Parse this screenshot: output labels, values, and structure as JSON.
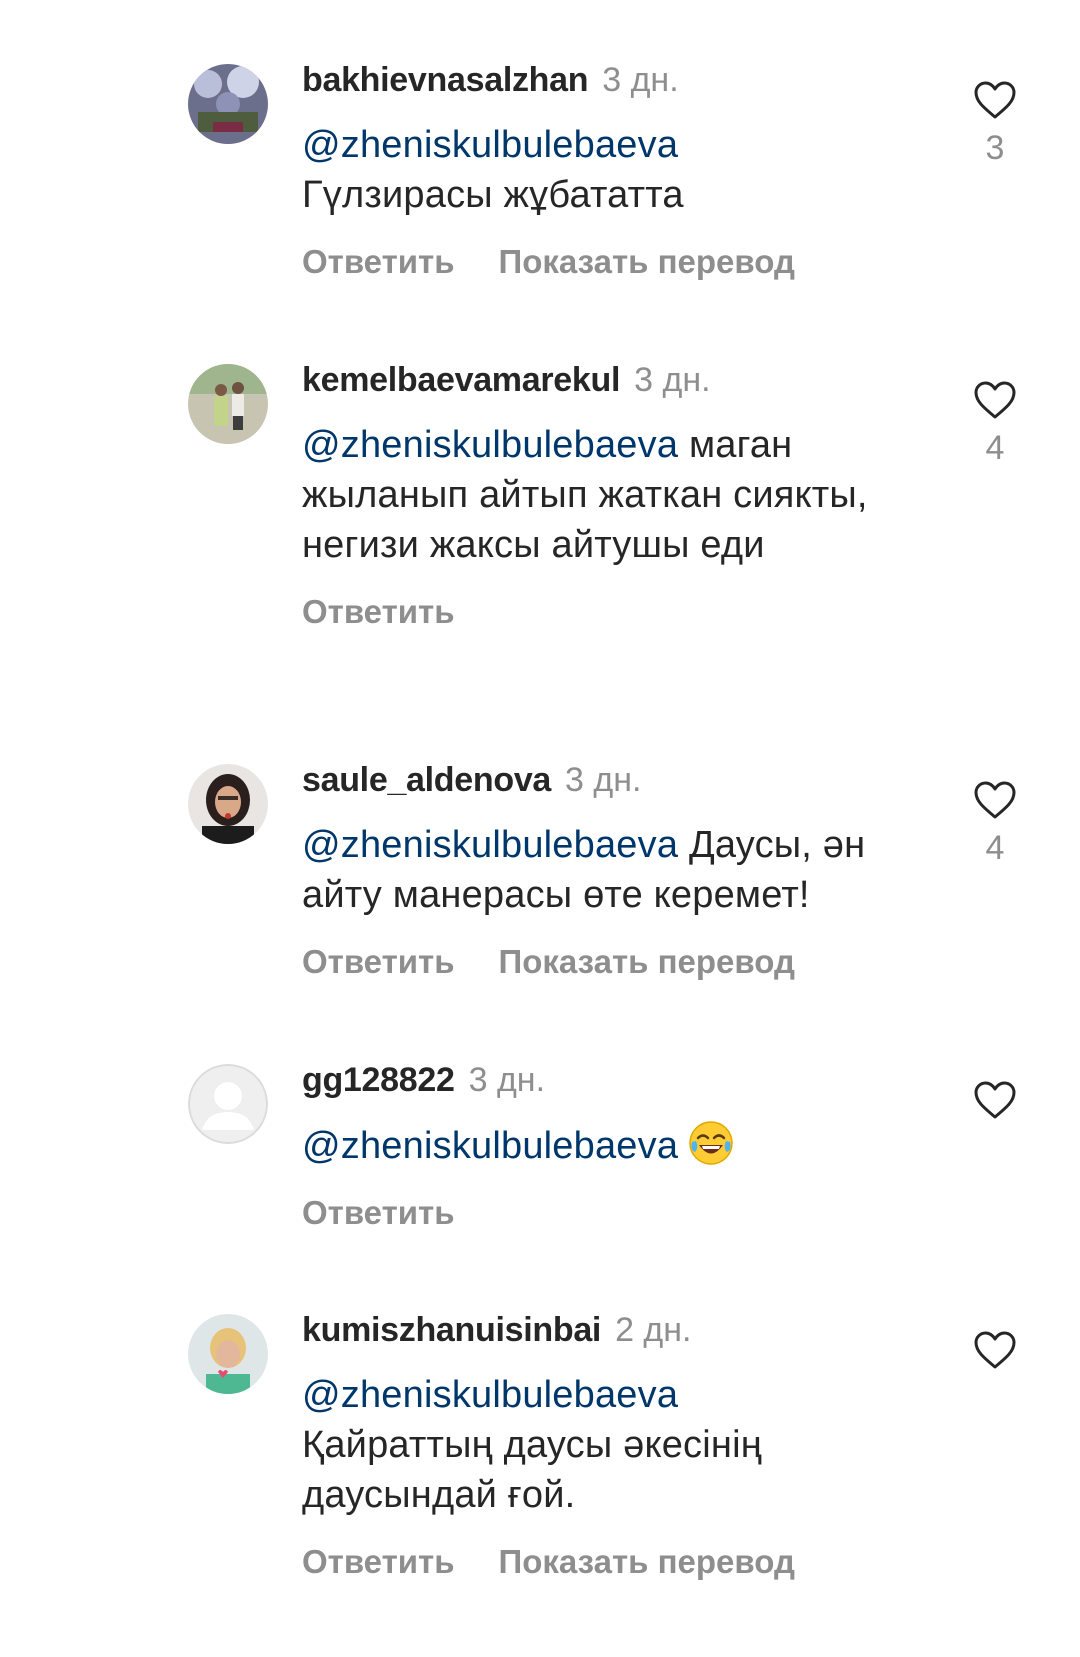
{
  "comments": [
    {
      "username": "bakhievnasalzhan",
      "time": "3 дн.",
      "mention": "@zheniskulbulebaeva",
      "text": "Гүлзирасы жұбататта",
      "reply_label": "Ответить",
      "translate_label": "Показать перевод",
      "likes": "3"
    },
    {
      "username": "kemelbaevamarekul",
      "time": "3 дн.",
      "mention": "@zheniskulbulebaeva",
      "text": "маган жыланып айтып жаткан сиякты, негизи жаксы айтушы еди",
      "reply_label": "Ответить",
      "likes": "4"
    },
    {
      "username": "saule_aldenova",
      "time": "3 дн.",
      "mention": "@zheniskulbulebaeva",
      "text": "Даусы, ән айту манерасы өте керемет!",
      "reply_label": "Ответить",
      "translate_label": "Показать перевод",
      "likes": "4"
    },
    {
      "username": "gg128822",
      "time": "3 дн.",
      "mention": "@zheniskulbulebaeva",
      "emoji": "tears-of-joy-emoji",
      "reply_label": "Ответить"
    },
    {
      "username": "kumiszhanuisinbai",
      "time": "2 дн.",
      "mention": "@zheniskulbulebaeva",
      "text": "Қайраттың даусы әкесінің даусындай ғой.",
      "reply_label": "Ответить",
      "translate_label": "Показать перевод"
    }
  ],
  "colors": {
    "text": "#262626",
    "secondary": "#8e8e8e",
    "mention": "#00376b"
  },
  "icons": {
    "like": "heart-outline-icon",
    "default_avatar": "default-avatar-icon"
  }
}
